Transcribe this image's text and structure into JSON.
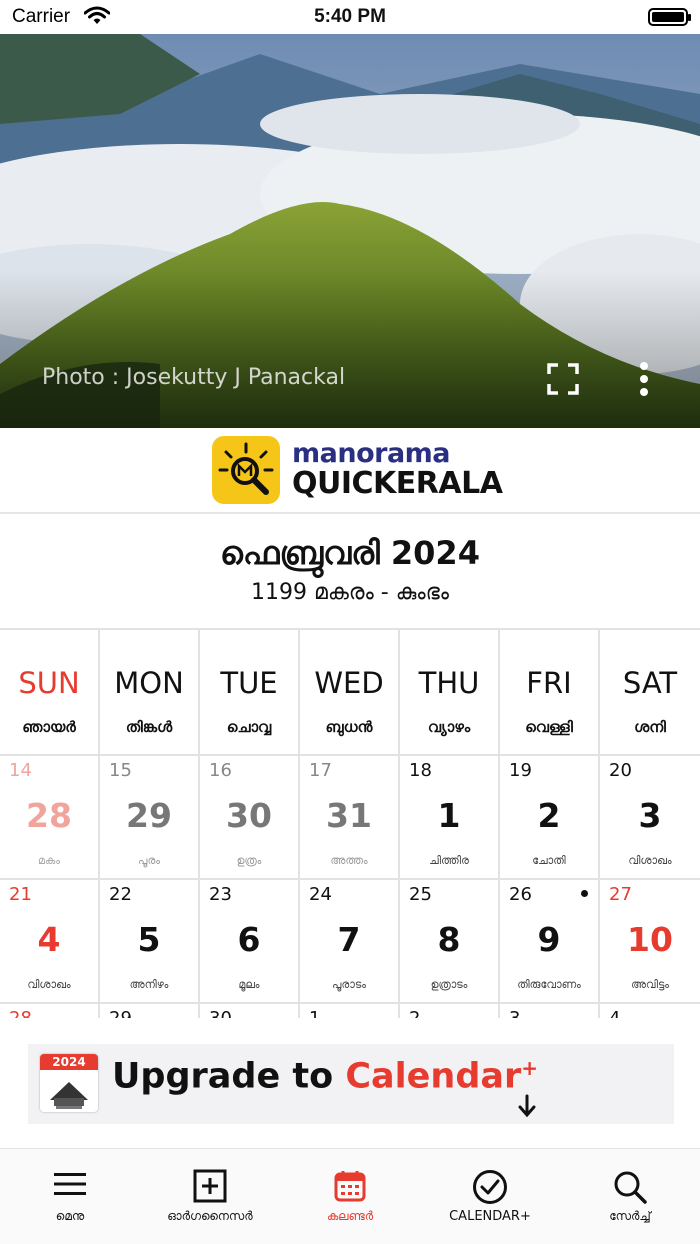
{
  "status_bar": {
    "carrier": "Carrier",
    "time": "5:40 PM"
  },
  "hero": {
    "photo_credit": "Photo : Josekutty J Panackal"
  },
  "logo": {
    "line1": "manorama",
    "line2": "QUICKERALA"
  },
  "month": {
    "title": "ഫെബ്രുവരി  2024",
    "subtitle": "1199 മകരം - കുംഭം"
  },
  "weekdays": [
    {
      "en": "SUN",
      "ml": "ഞായർ"
    },
    {
      "en": "MON",
      "ml": "തിങ്കൾ"
    },
    {
      "en": "TUE",
      "ml": "ചൊവ്വ"
    },
    {
      "en": "WED",
      "ml": "ബുധൻ"
    },
    {
      "en": "THU",
      "ml": "വ്യാഴം"
    },
    {
      "en": "FRI",
      "ml": "വെള്ളി"
    },
    {
      "en": "SAT",
      "ml": "ശനി"
    }
  ],
  "weeks": [
    [
      {
        "eng": "14",
        "ml": "28",
        "star": "മകം",
        "past": true
      },
      {
        "eng": "15",
        "ml": "29",
        "star": "പൂരം",
        "past": true
      },
      {
        "eng": "16",
        "ml": "30",
        "star": "ഉത്രം",
        "past": true
      },
      {
        "eng": "17",
        "ml": "31",
        "star": "അത്തം",
        "past": true
      },
      {
        "eng": "18",
        "ml": "1",
        "star": "ചിത്തിര",
        "past": false
      },
      {
        "eng": "19",
        "ml": "2",
        "star": "ചോതി",
        "past": false
      },
      {
        "eng": "20",
        "ml": "3",
        "star": "വിശാഖം",
        "past": false
      }
    ],
    [
      {
        "eng": "21",
        "ml": "4",
        "star": "വിശാഖം",
        "past": false
      },
      {
        "eng": "22",
        "ml": "5",
        "star": "അനിഴം",
        "past": false
      },
      {
        "eng": "23",
        "ml": "6",
        "star": "മൂലം",
        "past": false
      },
      {
        "eng": "24",
        "ml": "7",
        "star": "പൂരാടം",
        "past": false
      },
      {
        "eng": "25",
        "ml": "8",
        "star": "ഉത്രാടം",
        "past": false
      },
      {
        "eng": "26",
        "ml": "9",
        "star": "തിരുവോണം",
        "past": false,
        "event_dot": true
      },
      {
        "eng": "27",
        "ml": "10",
        "star": "അവിട്ടം",
        "past": false,
        "holiday": true
      }
    ],
    [
      {
        "eng": "28",
        "ml": "",
        "star": "",
        "past": false
      },
      {
        "eng": "29",
        "ml": "",
        "star": "",
        "past": false
      },
      {
        "eng": "30",
        "ml": "",
        "star": "",
        "past": false
      },
      {
        "eng": "1",
        "ml": "",
        "star": "",
        "past": false
      },
      {
        "eng": "2",
        "ml": "",
        "star": "",
        "past": false
      },
      {
        "eng": "3",
        "ml": "",
        "star": "",
        "past": false
      },
      {
        "eng": "4",
        "ml": "",
        "star": "",
        "past": false
      }
    ]
  ],
  "banner": {
    "badge_year": "2024",
    "text_prefix": "Upgrade to ",
    "text_accent": "Calendar",
    "plus": "+"
  },
  "tabs": [
    {
      "label": "മെനു",
      "icon": "menu-icon",
      "active": false
    },
    {
      "label": "ഓർഗനൈസർ",
      "icon": "plus-square-icon",
      "active": false
    },
    {
      "label": "കലണ്ടർ",
      "icon": "calendar-icon",
      "active": true
    },
    {
      "label": "CALENDAR+",
      "icon": "check-circle-icon",
      "active": false
    },
    {
      "label": "സേർച്ച്",
      "icon": "search-icon",
      "active": false
    }
  ],
  "colors": {
    "accent_red": "#e63b2e",
    "logo_yellow": "#f5c518",
    "logo_blue": "#2b2f82"
  }
}
